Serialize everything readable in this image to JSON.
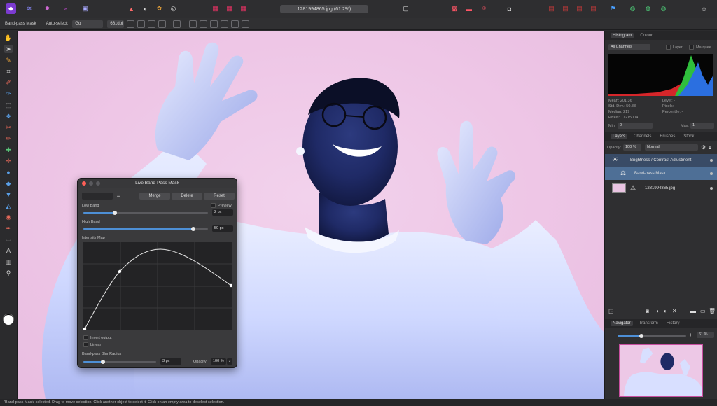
{
  "app": {
    "document_title": "1281994865.jpg (61.2%)"
  },
  "context_bar": {
    "tool_name": "Band-pass Mask",
    "auto_select_label": "Auto-select:",
    "auto_select_value": "Go",
    "dpi": "661dpi"
  },
  "tools": [
    "hand-icon",
    "move-icon",
    "pen-icon",
    "crop-icon",
    "brush-icon",
    "selection-brush-icon",
    "flood-select-icon",
    "paint-icon",
    "erase-icon",
    "clone-icon",
    "retouch-icon",
    "dodge-icon",
    "smudge-icon",
    "sharpen-icon",
    "fill-icon",
    "gradient-icon",
    "red-eye-icon",
    "vector-pen-icon",
    "shape-icon",
    "text-icon",
    "frame-icon",
    "zoom-icon"
  ],
  "histogram_panel": {
    "tabs": [
      "Histogram",
      "Colour"
    ],
    "active_tab": "Histogram",
    "channel": "All Channels",
    "layer_label": "Layer",
    "marquee_label": "Marquee",
    "mean": "Mean: 201.36",
    "std_dev": "Std. Dev.: 50.83",
    "median": "Median: 219",
    "pixels": "Pixels: 17215004",
    "level": "Level: -",
    "level_pixels": "Pixels: -",
    "percentile": "Percentile: -",
    "min_label": "Min:",
    "min_value": "0",
    "max_label": "Max:",
    "max_value": "1"
  },
  "layers_panel": {
    "tabs": [
      "Layers",
      "Channels",
      "Brushes",
      "Stock"
    ],
    "active_tab": "Layers",
    "opacity_label": "Opacity:",
    "opacity_value": "100 %",
    "blend_mode": "Normal",
    "layers": [
      {
        "name": "Brightness / Contrast Adjustment"
      },
      {
        "name": "Band-pass Mask"
      },
      {
        "name": "1281994865.jpg"
      }
    ]
  },
  "navigator_panel": {
    "tabs": [
      "Navigator",
      "Transform",
      "History"
    ],
    "active_tab": "Navigator",
    "zoom_value": "61 %",
    "zoom_level": 0.35
  },
  "dialog": {
    "title": "Live Band-Pass Mask",
    "merge_label": "Merge",
    "delete_label": "Delete",
    "reset_label": "Reset",
    "low_band_label": "Low Band",
    "preview_label": "Preview",
    "low_band_value": "2 px",
    "low_band_level": 0.25,
    "high_band_label": "High Band",
    "high_band_value": "50 px",
    "high_band_level": 0.88,
    "intensity_map_label": "Intensity Map",
    "invert_label": "Invert output",
    "linear_label": "Linear",
    "blur_radius_label": "Band-pass Blur Radius",
    "blur_radius_value": "3 px",
    "blur_radius_level": 0.27,
    "opacity_label": "Opacity:",
    "opacity_value": "100 %"
  },
  "status_bar": {
    "text": "'Band-pass Mask' selected. Drag to move selection. Click another object to select it. Click on an empty area to deselect selection."
  },
  "colors": {
    "accent": "#4d8fd6",
    "canvas_background": "#eec6e6",
    "selection_highlight": "#4e6f96"
  }
}
